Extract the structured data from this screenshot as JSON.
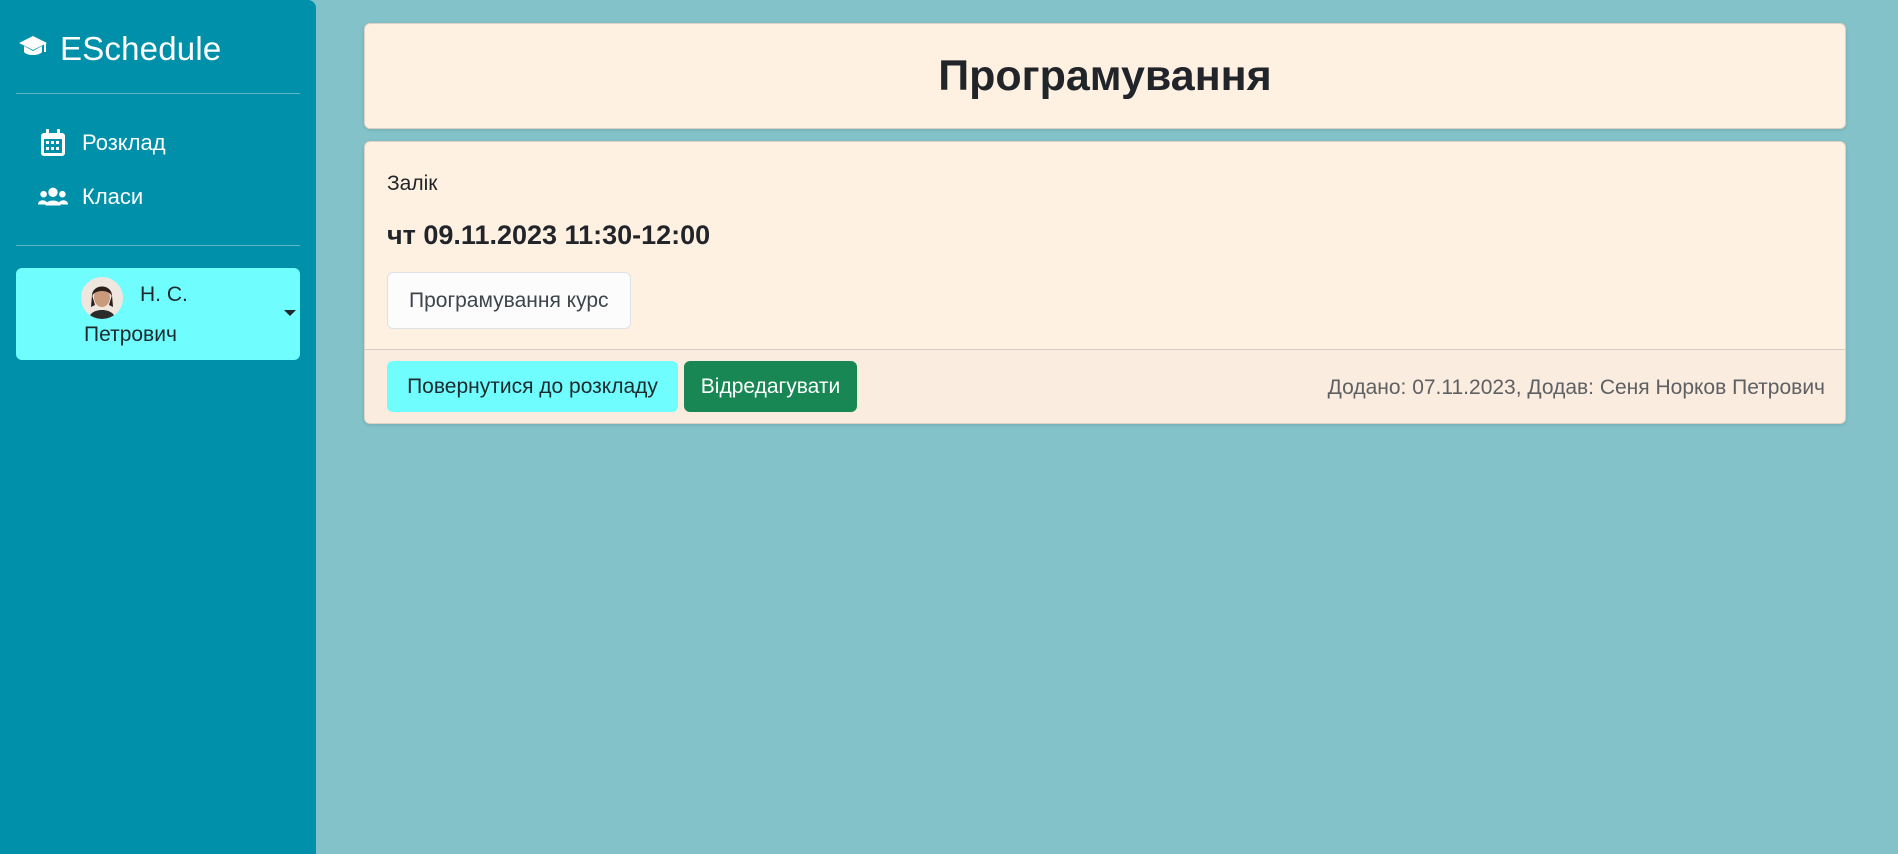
{
  "sidebar": {
    "brand": "ESchedule",
    "brand_icon": "graduation-cap-icon",
    "nav": [
      {
        "label": "Розклад",
        "icon": "calendar-icon"
      },
      {
        "label": "Класи",
        "icon": "users-icon"
      }
    ],
    "user": {
      "short_name": "Н. С.",
      "last_line": "Петрович",
      "dropdown_icon": "caret-down-icon"
    }
  },
  "page": {
    "title": "Програмування"
  },
  "event": {
    "type": "Залік",
    "datetime": "чт 09.11.2023 11:30-12:00",
    "course": "Програмування курс",
    "buttons": {
      "back": "Повернутися до розкладу",
      "edit": "Відредагувати"
    },
    "meta": "Додано: 07.11.2023, Додав: Сеня Норков Петрович"
  },
  "colors": {
    "sidebar": "#0090aa",
    "background": "#82c2c8",
    "card": "#fff1e2",
    "accent": "#6ffdfd",
    "success": "#198754"
  }
}
